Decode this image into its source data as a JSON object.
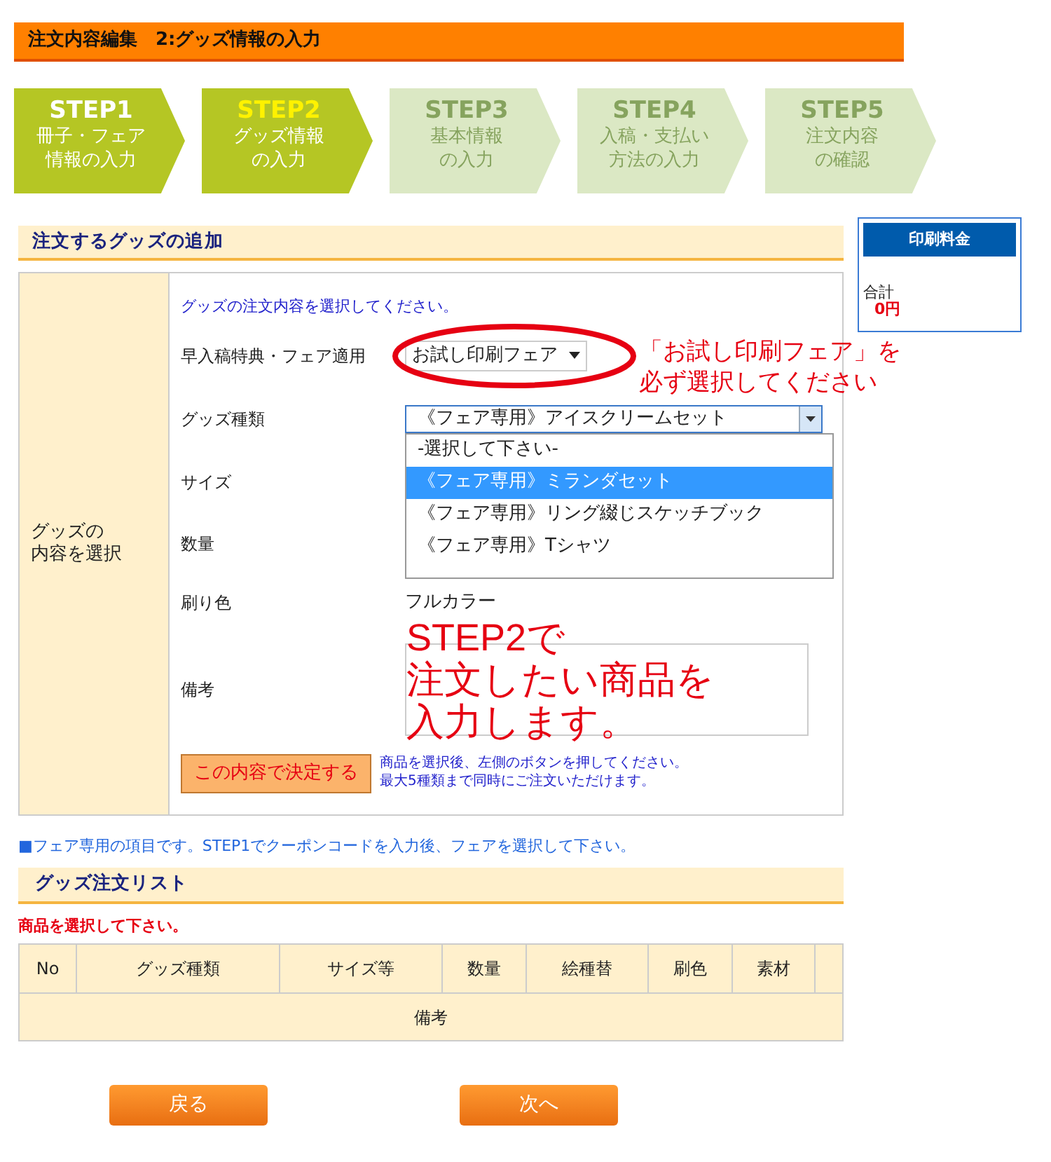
{
  "header": {
    "title": "注文内容編集　2:グッズ情報の入力"
  },
  "steps": [
    {
      "label": "STEP1",
      "lines": [
        "冊子・フェア",
        "情報の入力"
      ],
      "reached": true,
      "selected": false
    },
    {
      "label": "STEP2",
      "lines": [
        "グッズ情報",
        "の入力"
      ],
      "reached": true,
      "selected": true
    },
    {
      "label": "STEP3",
      "lines": [
        "基本情報",
        "の入力"
      ],
      "reached": false,
      "selected": false
    },
    {
      "label": "STEP4",
      "lines": [
        "入稿・支払い",
        "方法の入力"
      ],
      "reached": false,
      "selected": false
    },
    {
      "label": "STEP5",
      "lines": [
        "注文内容",
        "の確認"
      ],
      "reached": false,
      "selected": false
    }
  ],
  "add_section": {
    "title": "注文するグッズの追加",
    "side_label": [
      "グッズの",
      "内容を選択"
    ],
    "intro": "グッズの注文内容を選択してください。",
    "rows": [
      {
        "kind": "select",
        "label": "早入稿特典・フェア適用",
        "value": "お試し印刷フェア",
        "circled": true
      },
      {
        "kind": "combo",
        "label": "グッズ種類",
        "value": "《フェア専用》アイスクリームセット",
        "expanded": true,
        "options": [
          {
            "label": "-選択して下さい-",
            "selected": false
          },
          {
            "label": "《フェア専用》ミランダセット",
            "selected": true
          },
          {
            "label": "《フェア専用》リング綴じスケッチブック",
            "selected": false
          },
          {
            "label": "《フェア専用》Tシャツ",
            "selected": false
          }
        ]
      },
      {
        "kind": "empty",
        "label": "サイズ"
      },
      {
        "kind": "empty",
        "label": "数量"
      },
      {
        "kind": "text",
        "label": "刷り色",
        "value": "フルカラー"
      },
      {
        "kind": "textarea",
        "label": "備考"
      }
    ],
    "submit": "この内容で決定する",
    "hint": [
      "商品を選択後、左側のボタンを押してください。",
      "最大5種類まで同時にご注文いただけます。"
    ]
  },
  "note": "■フェア専用の項目です。STEP1でクーポンコードを入力後、フェアを選択して下さい。",
  "price": {
    "title": "印刷料金",
    "total_label": "合計",
    "total": "0円"
  },
  "list_section": {
    "title": "グッズ注文リスト",
    "warning": "商品を選択して下さい。",
    "columns": [
      "No",
      "グッズ種類",
      "サイズ等",
      "数量",
      "絵種替",
      "刷色",
      "素材"
    ],
    "remark": "備考"
  },
  "buttons": {
    "back": "戻る",
    "next": "次へ"
  },
  "annotations": {
    "callout": [
      "「お試し印刷フェア」を",
      "必ず選択してください"
    ],
    "big": [
      "STEP2で",
      "注文したい商品を",
      "入力します。"
    ]
  }
}
